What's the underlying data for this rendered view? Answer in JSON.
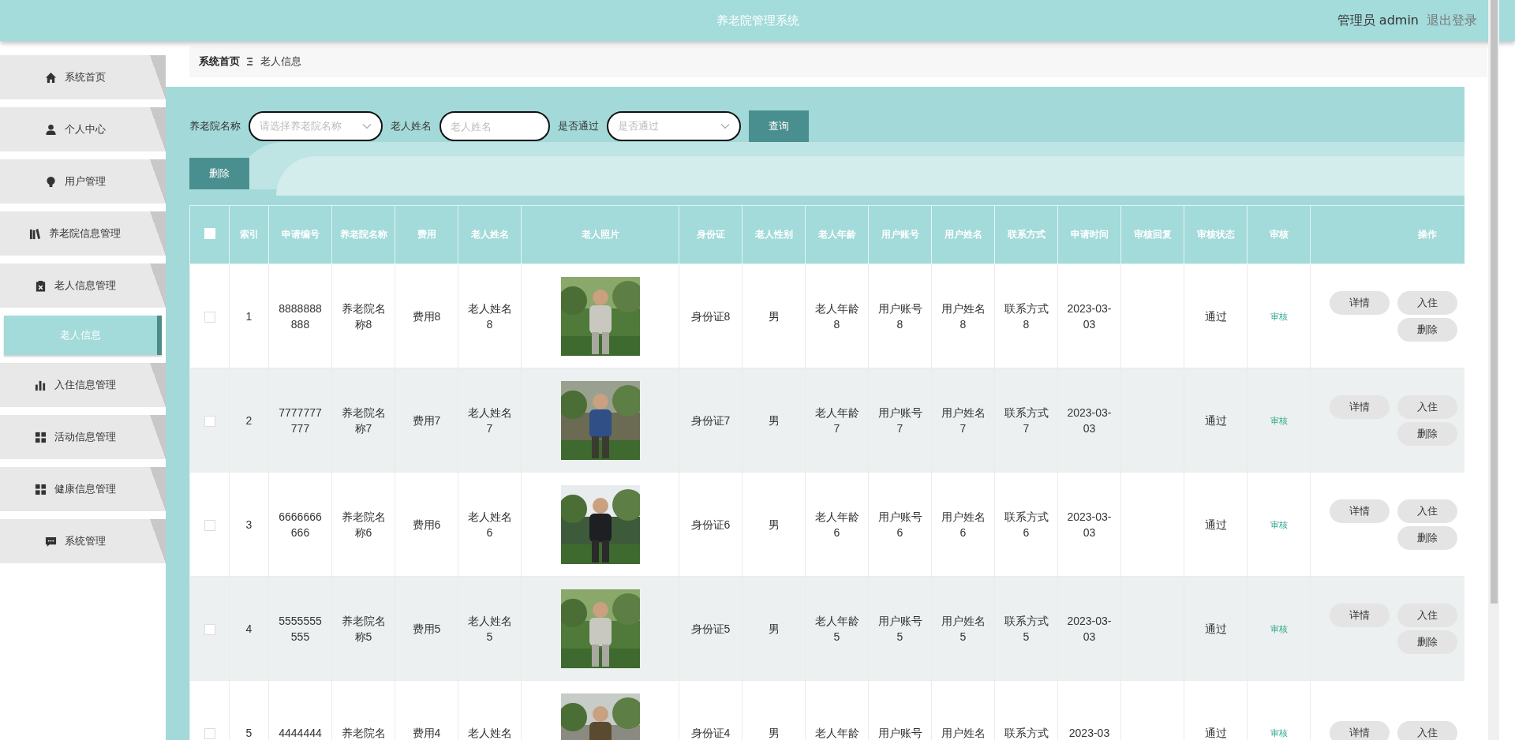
{
  "header": {
    "title": "养老院管理系统",
    "user": "管理员 admin",
    "logout": "退出登录"
  },
  "sidebar": {
    "items": [
      {
        "label": "系统首页",
        "selected": false
      },
      {
        "label": "个人中心",
        "selected": false
      },
      {
        "label": "用户管理",
        "selected": false
      },
      {
        "label": "养老院信息管理",
        "selected": false
      },
      {
        "label": "老人信息管理",
        "selected": false,
        "children": [
          {
            "label": "老人信息",
            "selected": true
          }
        ]
      },
      {
        "label": "入住信息管理",
        "selected": false
      },
      {
        "label": "活动信息管理",
        "selected": false
      },
      {
        "label": "健康信息管理",
        "selected": false
      },
      {
        "label": "系统管理",
        "selected": false
      }
    ]
  },
  "breadcrumb": [
    "系统首页",
    "老人信息"
  ],
  "search": {
    "fields": [
      {
        "label": "养老院名称",
        "placeholder": "请选择养老院名称",
        "kind": "select"
      },
      {
        "label": "老人姓名",
        "placeholder": "老人姓名",
        "kind": "input"
      },
      {
        "label": "是否通过",
        "placeholder": "是否通过",
        "kind": "select"
      }
    ],
    "query_button": "查询",
    "delete_button": "删除"
  },
  "table": {
    "header_checkbox": {
      "checked": false
    },
    "columns": [
      "索引",
      "申请编号",
      "养老院名称",
      "费用",
      "老人姓名",
      "老人照片",
      "身份证",
      "老人性别",
      "老人年龄",
      "用户账号",
      "用户姓名",
      "联系方式",
      "申请时间",
      "审核回复",
      "审核状态",
      "审核",
      "操作"
    ],
    "rows": [
      {
        "checked": false,
        "cells": [
          "1",
          "8888888888",
          "养老院名称8",
          "费用8",
          "老人姓名8",
          {
            "kind": "picture"
          },
          "身份证8",
          "男",
          "老人年龄8",
          "用户账号8",
          "用户姓名8",
          "联系方式8",
          "2023-03-03",
          "",
          "通过",
          "审核"
        ],
        "actions": [
          "详情",
          "入住",
          "删除"
        ]
      },
      {
        "checked": false,
        "cells": [
          "2",
          "7777777777",
          "养老院名称7",
          "费用7",
          "老人姓名7",
          {
            "kind": "picture"
          },
          "身份证7",
          "男",
          "老人年龄7",
          "用户账号7",
          "用户姓名7",
          "联系方式7",
          "2023-03-03",
          "",
          "通过",
          "审核"
        ],
        "actions": [
          "详情",
          "入住",
          "删除"
        ]
      },
      {
        "checked": false,
        "cells": [
          "3",
          "6666666666",
          "养老院名称6",
          "费用6",
          "老人姓名6",
          {
            "kind": "picture"
          },
          "身份证6",
          "男",
          "老人年龄6",
          "用户账号6",
          "用户姓名6",
          "联系方式6",
          "2023-03-03",
          "",
          "通过",
          "审核"
        ],
        "actions": [
          "详情",
          "入住",
          "删除"
        ]
      },
      {
        "checked": false,
        "cells": [
          "4",
          "5555555555",
          "养老院名称5",
          "费用5",
          "老人姓名5",
          {
            "kind": "picture"
          },
          "身份证5",
          "男",
          "老人年龄5",
          "用户账号5",
          "用户姓名5",
          "联系方式5",
          "2023-03-03",
          "",
          "通过",
          "审核"
        ],
        "actions": [
          "详情",
          "入住",
          "删除"
        ]
      },
      {
        "checked": false,
        "cells": [
          "5",
          "4444444",
          "养老院名",
          "费用4",
          "老人姓名",
          {
            "kind": "picture"
          },
          "身份证4",
          "男",
          "老人年龄",
          "用户账号",
          "用户姓名",
          "联系方式",
          "2023-03",
          "",
          "通过",
          "审核"
        ],
        "actions": [
          "详情",
          "入住"
        ]
      }
    ]
  }
}
